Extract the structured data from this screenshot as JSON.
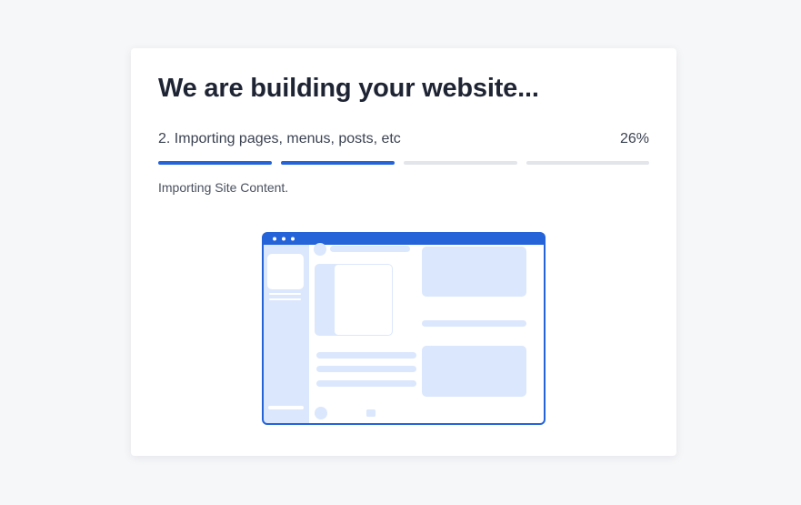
{
  "title": "We are building your website...",
  "step": {
    "label": "2. Importing pages, menus, posts, etc",
    "percent": "26%",
    "progress_fraction": 0.26
  },
  "progress": {
    "segments": [
      {
        "state": "complete"
      },
      {
        "state": "active"
      },
      {
        "state": "pending"
      },
      {
        "state": "pending"
      }
    ]
  },
  "status_text": "Importing Site Content.",
  "colors": {
    "accent": "#2563d9",
    "placeholder_fill": "#dbe7fd",
    "track": "#e2e5ea",
    "title_text": "#1e2433"
  },
  "illustration": {
    "icon": "website-preview-illustration"
  }
}
